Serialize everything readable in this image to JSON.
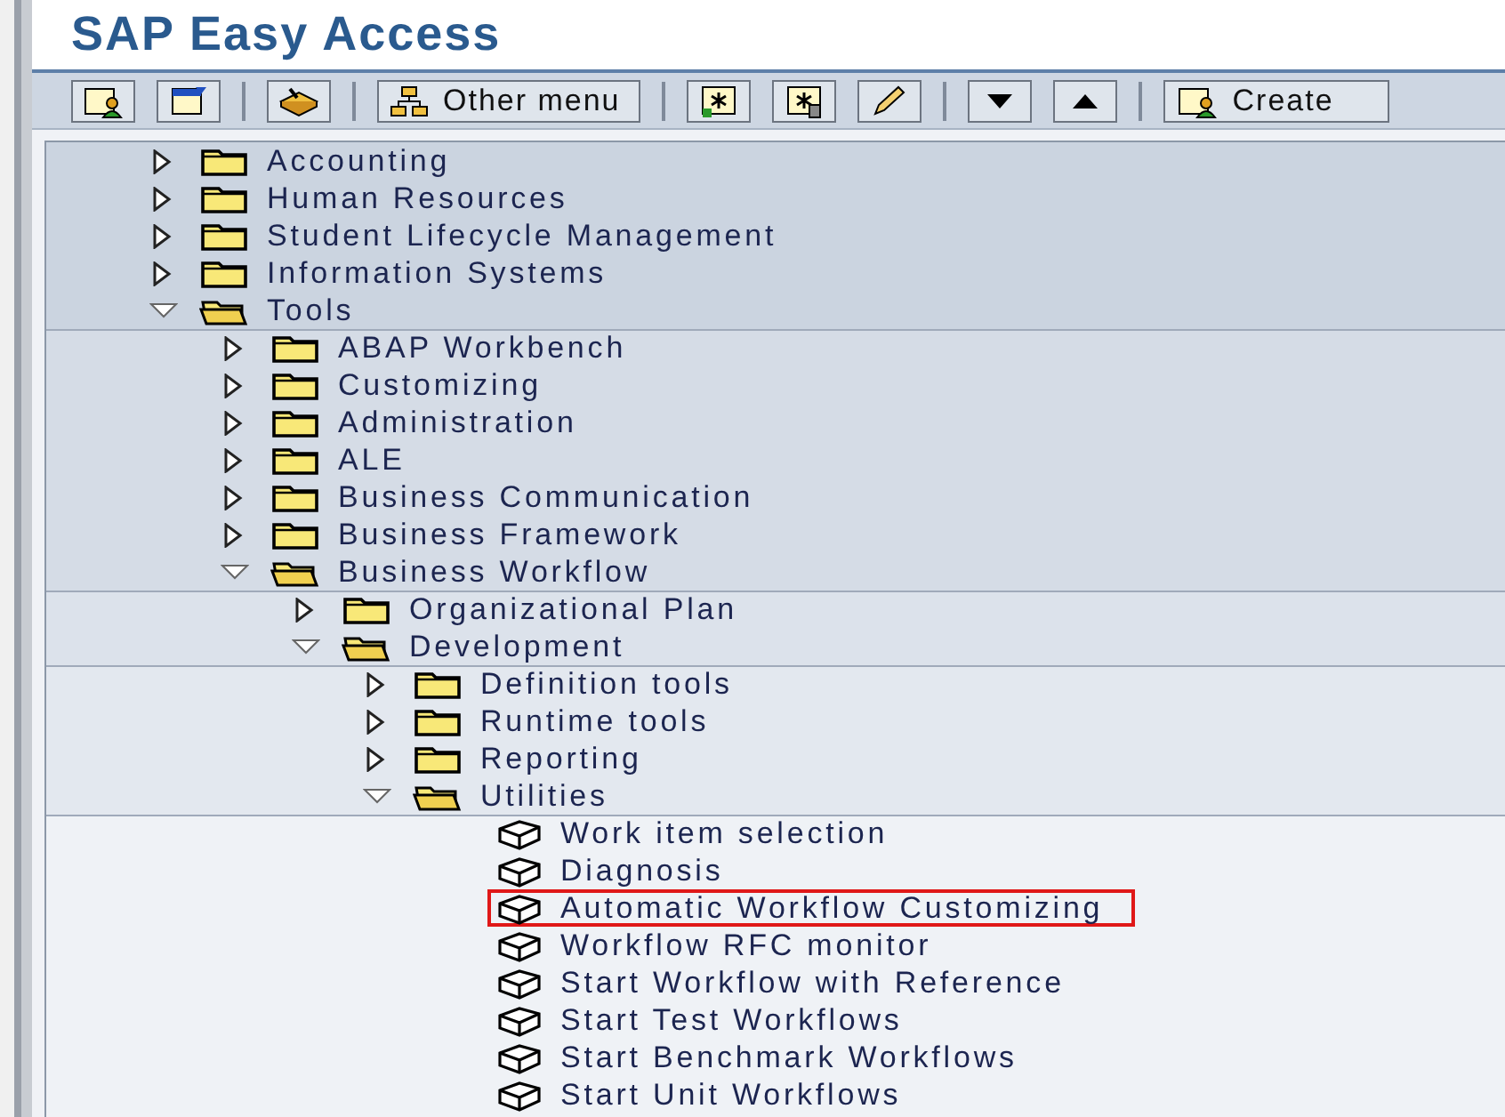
{
  "window": {
    "title": "SAP Easy Access"
  },
  "toolbar": {
    "other_menu": "Other menu",
    "create": "Create"
  },
  "tree": [
    {
      "label": "Accounting",
      "kind": "folder",
      "expanded": false
    },
    {
      "label": "Human Resources",
      "kind": "folder",
      "expanded": false
    },
    {
      "label": "Student Lifecycle Management",
      "kind": "folder",
      "expanded": false
    },
    {
      "label": "Information Systems",
      "kind": "folder",
      "expanded": false
    },
    {
      "label": "Tools",
      "kind": "folder",
      "expanded": true,
      "children": [
        {
          "label": "ABAP Workbench",
          "kind": "folder",
          "expanded": false
        },
        {
          "label": "Customizing",
          "kind": "folder",
          "expanded": false
        },
        {
          "label": "Administration",
          "kind": "folder",
          "expanded": false
        },
        {
          "label": "ALE",
          "kind": "folder",
          "expanded": false
        },
        {
          "label": "Business Communication",
          "kind": "folder",
          "expanded": false
        },
        {
          "label": "Business Framework",
          "kind": "folder",
          "expanded": false
        },
        {
          "label": "Business Workflow",
          "kind": "folder",
          "expanded": true,
          "children": [
            {
              "label": "Organizational Plan",
              "kind": "folder",
              "expanded": false
            },
            {
              "label": "Development",
              "kind": "folder",
              "expanded": true,
              "children": [
                {
                  "label": "Definition tools",
                  "kind": "folder",
                  "expanded": false
                },
                {
                  "label": "Runtime tools",
                  "kind": "folder",
                  "expanded": false
                },
                {
                  "label": "Reporting",
                  "kind": "folder",
                  "expanded": false
                },
                {
                  "label": "Utilities",
                  "kind": "folder",
                  "expanded": true,
                  "children": [
                    {
                      "label": "Work item selection",
                      "kind": "transaction",
                      "highlighted": false
                    },
                    {
                      "label": "Diagnosis",
                      "kind": "transaction",
                      "highlighted": false
                    },
                    {
                      "label": "Automatic Workflow Customizing",
                      "kind": "transaction",
                      "highlighted": true
                    },
                    {
                      "label": "Workflow RFC monitor",
                      "kind": "transaction",
                      "highlighted": false
                    },
                    {
                      "label": "Start Workflow with Reference",
                      "kind": "transaction",
                      "highlighted": false
                    },
                    {
                      "label": "Start Test Workflows",
                      "kind": "transaction",
                      "highlighted": false
                    },
                    {
                      "label": "Start Benchmark Workflows",
                      "kind": "transaction",
                      "highlighted": false
                    },
                    {
                      "label": "Start Unit Workflows",
                      "kind": "transaction",
                      "highlighted": false
                    }
                  ]
                }
              ]
            }
          ]
        }
      ]
    }
  ]
}
